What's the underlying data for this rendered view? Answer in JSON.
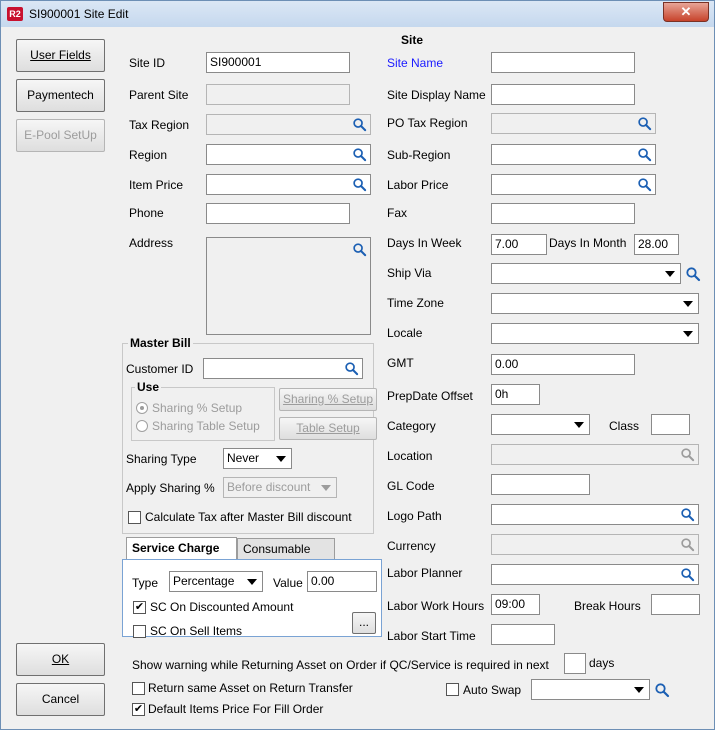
{
  "window": {
    "icon_text": "R2",
    "title": "SI900001 Site Edit",
    "close_glyph": "✕"
  },
  "sidebar": {
    "user_fields": "User Fields",
    "paymentech": "Paymentech",
    "epool_setup": "E-Pool SetUp",
    "ok": "OK",
    "cancel": "Cancel"
  },
  "site": {
    "section_title": "Site",
    "site_id_label": "Site ID",
    "site_id_value": "SI900001",
    "site_name_label": "Site Name",
    "site_name_value": "",
    "parent_site_label": "Parent Site",
    "site_display_name_label": "Site Display Name",
    "tax_region_label": "Tax Region",
    "po_tax_region_label": "PO Tax Region",
    "region_label": "Region",
    "sub_region_label": "Sub-Region",
    "item_price_label": "Item Price",
    "labor_price_label": "Labor Price",
    "phone_label": "Phone",
    "fax_label": "Fax",
    "address_label": "Address",
    "days_in_week_label": "Days In Week",
    "days_in_week_value": "7.00",
    "days_in_month_label": "Days In Month",
    "days_in_month_value": "28.00",
    "ship_via_label": "Ship Via",
    "time_zone_label": "Time Zone",
    "locale_label": "Locale",
    "gmt_label": "GMT",
    "gmt_value": "0.00",
    "prepdate_offset_label": "PrepDate Offset",
    "prepdate_offset_value": "0h",
    "category_label": "Category",
    "class_label": "Class",
    "location_label": "Location",
    "gl_code_label": "GL Code",
    "logo_path_label": "Logo Path",
    "currency_label": "Currency",
    "labor_planner_label": "Labor Planner",
    "labor_work_hours_label": "Labor Work Hours",
    "labor_work_hours_value": "09:00",
    "break_hours_label": "Break Hours",
    "labor_start_time_label": "Labor Start Time"
  },
  "master_bill": {
    "title": "Master Bill",
    "customer_id_label": "Customer ID",
    "use_title": "Use",
    "sharing_pct_setup": "Sharing % Setup",
    "sharing_table_setup": "Sharing Table Setup",
    "sharing_pct_setup_btn": "Sharing % Setup",
    "table_setup_btn": "Table Setup",
    "sharing_type_label": "Sharing Type",
    "sharing_type_value": "Never",
    "apply_sharing_label": "Apply Sharing %",
    "apply_sharing_value": "Before discount",
    "calc_tax_label": "Calculate Tax after Master Bill discount"
  },
  "tabs": {
    "service_charge": "Service Charge",
    "consumable": "Consumable"
  },
  "service_charge": {
    "type_label": "Type",
    "type_value": "Percentage",
    "value_label": "Value",
    "value_value": "0.00",
    "sc_discounted_label": "SC On Discounted Amount",
    "sc_discounted_check": "✔",
    "sc_sell_items_label": "SC On Sell Items",
    "ellipsis": "..."
  },
  "footer": {
    "warning_label": "Show warning while Returning Asset on Order if QC/Service is required in next",
    "days_label": "days",
    "return_same_asset_label": "Return same Asset on Return Transfer",
    "auto_swap_label": "Auto Swap",
    "default_items_price_label": "Default Items Price For Fill Order",
    "default_items_price_check": "✔"
  },
  "colors": {
    "site_name_label": "#1a1aff",
    "close_button": "#c7432b"
  }
}
